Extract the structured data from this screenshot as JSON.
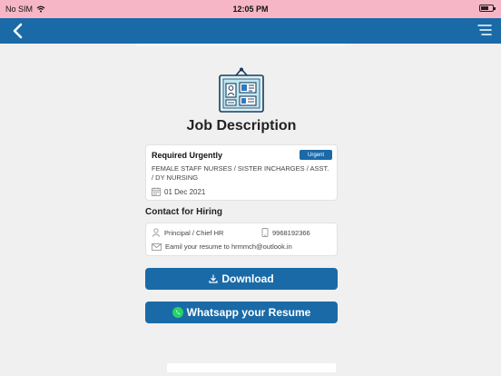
{
  "status_bar": {
    "carrier": "No SIM",
    "time": "12:05 PM"
  },
  "nav": {
    "back_icon": "chevron-left-icon",
    "menu_icon": "filter-menu-icon"
  },
  "page": {
    "title": "Job Description",
    "icon": "job-board-icon"
  },
  "job": {
    "heading": "Required Urgently",
    "badge": "Urgent",
    "positions": "FEMALE STAFF NURSES / SISTER INCHARGES / ASST. / DY NURSING",
    "date": "01 Dec 2021"
  },
  "contact": {
    "heading": "Contact for Hiring",
    "person": "Principal / Chief HR",
    "phone": "9968192366",
    "email_text": "Eamil your resume to hrmmch@outlook.in"
  },
  "actions": {
    "download_label": "Download",
    "whatsapp_label": "Whatsapp your Resume"
  },
  "colors": {
    "primary": "#1a6aa8",
    "status_bar": "#f6b6c6",
    "background": "#f0f0f0",
    "whatsapp": "#25d366"
  }
}
